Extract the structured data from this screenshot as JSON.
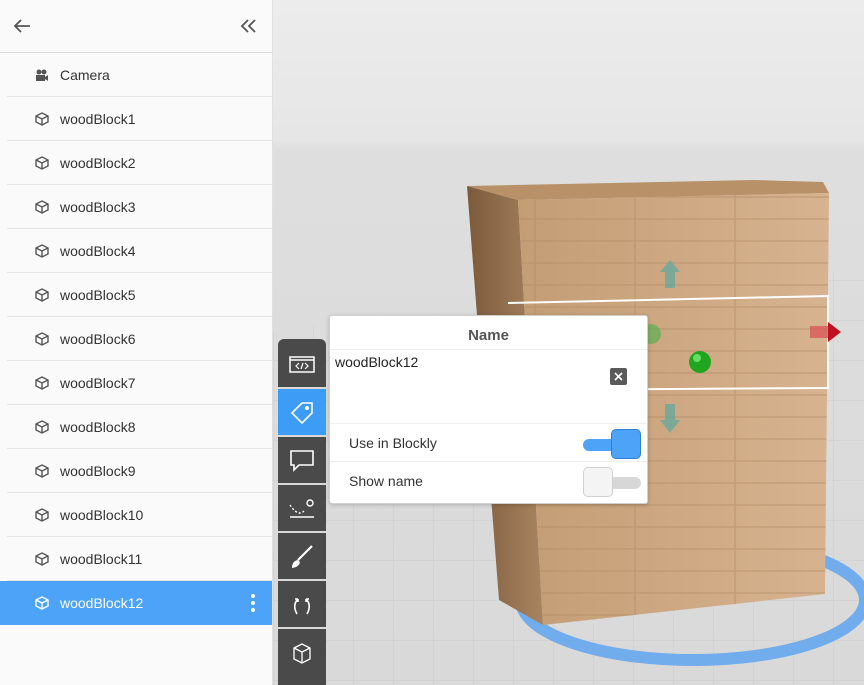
{
  "sidebar": {
    "items": [
      {
        "label": "Camera",
        "icon": "camera-icon"
      },
      {
        "label": "woodBlock1",
        "icon": "cube-icon"
      },
      {
        "label": "woodBlock2",
        "icon": "cube-icon"
      },
      {
        "label": "woodBlock3",
        "icon": "cube-icon"
      },
      {
        "label": "woodBlock4",
        "icon": "cube-icon"
      },
      {
        "label": "woodBlock5",
        "icon": "cube-icon"
      },
      {
        "label": "woodBlock6",
        "icon": "cube-icon"
      },
      {
        "label": "woodBlock7",
        "icon": "cube-icon"
      },
      {
        "label": "woodBlock8",
        "icon": "cube-icon"
      },
      {
        "label": "woodBlock9",
        "icon": "cube-icon"
      },
      {
        "label": "woodBlock10",
        "icon": "cube-icon"
      },
      {
        "label": "woodBlock11",
        "icon": "cube-icon"
      },
      {
        "label": "woodBlock12",
        "icon": "cube-icon",
        "selected": true
      }
    ]
  },
  "tools": [
    {
      "name": "code-tool",
      "icon": "code-icon"
    },
    {
      "name": "tag-tool",
      "icon": "tag-icon",
      "active": true
    },
    {
      "name": "speech-tool",
      "icon": "speech-bubble-icon"
    },
    {
      "name": "physics-tool",
      "icon": "trajectory-icon"
    },
    {
      "name": "paint-tool",
      "icon": "brush-icon"
    },
    {
      "name": "animation-tool",
      "icon": "arrows-icon"
    },
    {
      "name": "scene-tool",
      "icon": "box-icon"
    }
  ],
  "popup": {
    "title": "Name",
    "name_value": "woodBlock12",
    "use_in_blockly": {
      "label": "Use in Blockly",
      "on": true
    },
    "show_name": {
      "label": "Show name",
      "on": false
    }
  },
  "colors": {
    "accent": "#4da3f7",
    "toolbar": "#4a4a4a"
  }
}
